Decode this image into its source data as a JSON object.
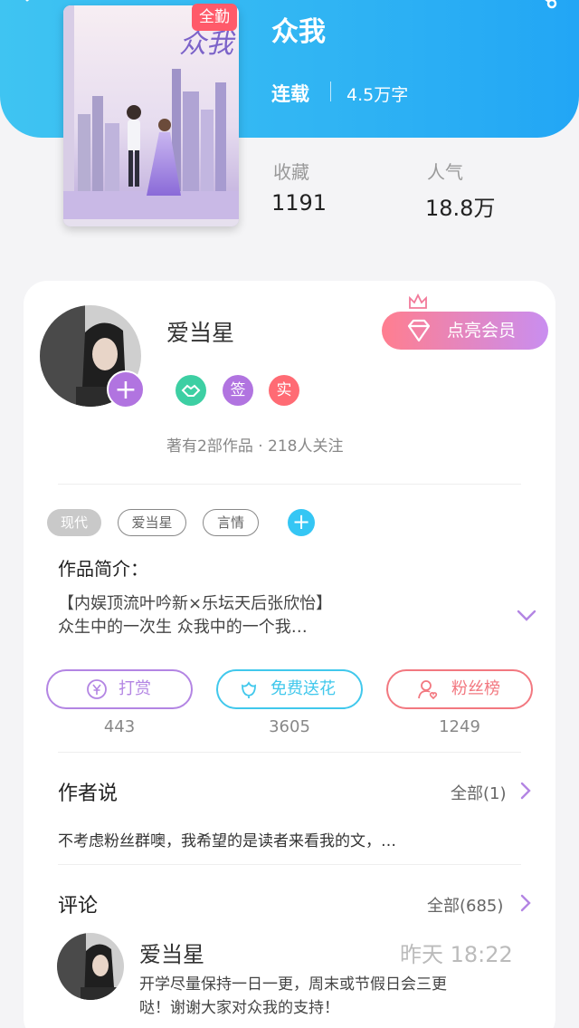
{
  "book": {
    "badge": "全勤",
    "title": "众我",
    "status": "连载",
    "word_count": "4.5万字",
    "cover_title": "众我",
    "stats": [
      {
        "label": "收藏",
        "value": "1191"
      },
      {
        "label": "人气",
        "value": "18.8万"
      }
    ]
  },
  "author": {
    "name": "爱当星",
    "follow_symbol": "+",
    "vip_label": "点亮会员",
    "badges": [
      {
        "text": "",
        "icon": "handshake-icon",
        "color": "#3dcfa3"
      },
      {
        "text": "签",
        "color": "#b174e0"
      },
      {
        "text": "实",
        "color": "#ff6b74"
      }
    ],
    "works_info": "著有2部作品 · 218人关注"
  },
  "tags": [
    "现代",
    "爱当星",
    "言情"
  ],
  "tag_add_symbol": "+",
  "intro": {
    "title": "作品简介：",
    "line1": "【内娱顶流叶吟新×乐坛天后张欣怡】",
    "line2": "众生中的一次生 众我中的一个我…"
  },
  "actions": [
    {
      "label": "打赏",
      "count": "443",
      "color": "#b385e3",
      "icon": "yen-icon"
    },
    {
      "label": "免费送花",
      "count": "3605",
      "color": "#41c8ec",
      "icon": "flower-icon"
    },
    {
      "label": "粉丝榜",
      "count": "1249",
      "color": "#f27880",
      "icon": "fan-rank-icon"
    }
  ],
  "author_say": {
    "title": "作者说",
    "link": "全部(1)",
    "text": "不考虑粉丝群噢，我希望的是读者来看我的文，…"
  },
  "comments": {
    "title": "评论",
    "link": "全部(685)",
    "items": [
      {
        "name": "爱当星",
        "time": "昨天 18:22",
        "line1": "开学尽量保持一日一更，周末或节假日会三更",
        "line2": "哒！谢谢大家对众我的支持！"
      }
    ]
  }
}
